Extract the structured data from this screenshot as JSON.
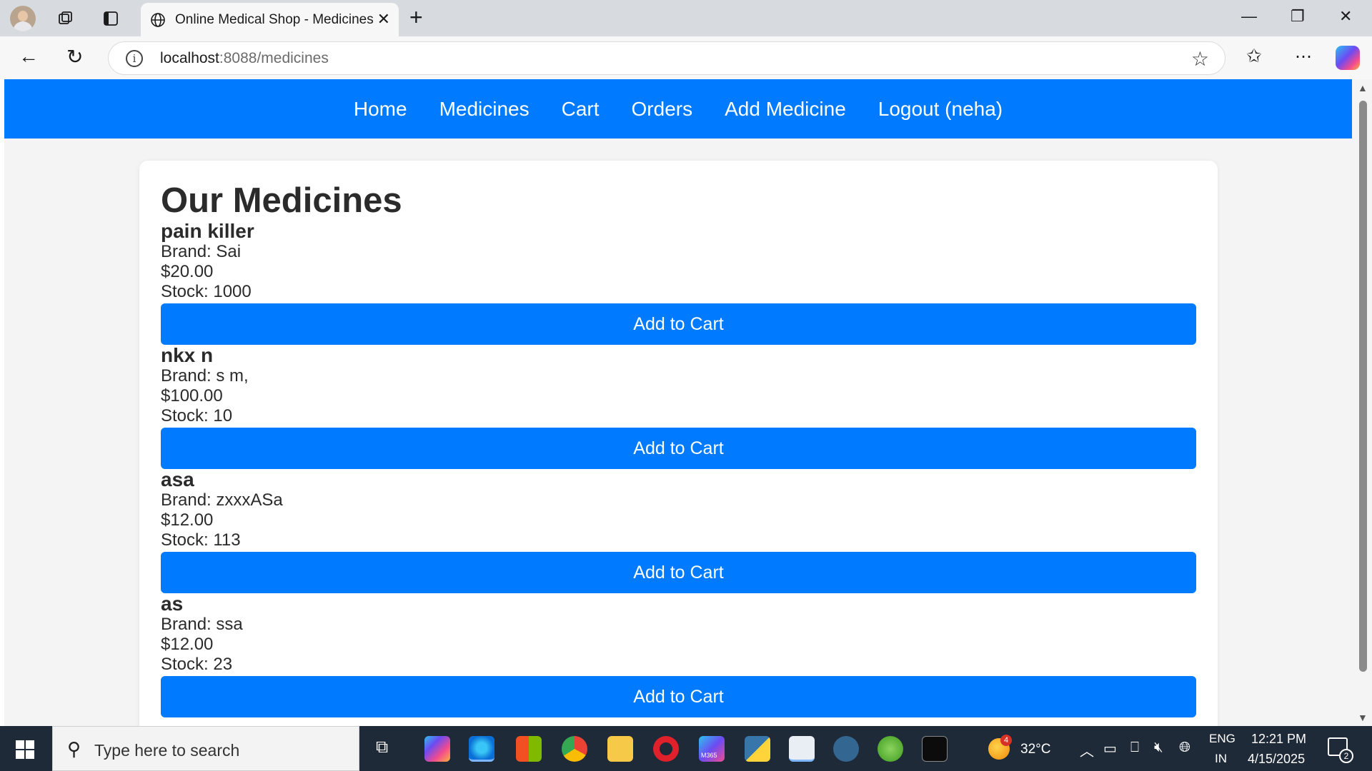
{
  "browser": {
    "tab_title": "Online Medical Shop - Medicines",
    "url_host": "localhost",
    "url_path": ":8088/medicines",
    "icons": [
      "profile-avatar",
      "collections-icon",
      "tab-actions-icon",
      "globe-icon",
      "close-icon",
      "new-tab-icon",
      "minimize-icon",
      "restore-icon",
      "window-close-icon",
      "back-icon",
      "refresh-icon",
      "info-icon",
      "favorite-star-icon",
      "favorites-icon",
      "more-icon",
      "copilot-icon"
    ]
  },
  "site_nav": {
    "items": [
      "Home",
      "Medicines",
      "Cart",
      "Orders",
      "Add Medicine",
      "Logout (neha)"
    ],
    "color": "#007bff"
  },
  "page": {
    "title": "Our Medicines",
    "add_label": "Add to Cart",
    "medicines": [
      {
        "name": "pain killer",
        "brand": "Brand: Sai",
        "price": "$20.00",
        "stock": "Stock: 1000"
      },
      {
        "name": "nkx n",
        "brand": "Brand: s m,",
        "price": "$100.00",
        "stock": "Stock: 10"
      },
      {
        "name": "asa",
        "brand": "Brand: zxxxASa",
        "price": "$12.00",
        "stock": "Stock: 113"
      },
      {
        "name": "as",
        "brand": "Brand: ssa",
        "price": "$12.00",
        "stock": "Stock: 23"
      }
    ]
  },
  "taskbar": {
    "search_placeholder": "Type here to search",
    "weather_temp": "32°C",
    "weather_badge": "4",
    "lang_top": "ENG",
    "lang_bottom": "IN",
    "time": "12:21 PM",
    "date": "4/15/2025",
    "notification_count": "2",
    "m365_label": "M365"
  }
}
